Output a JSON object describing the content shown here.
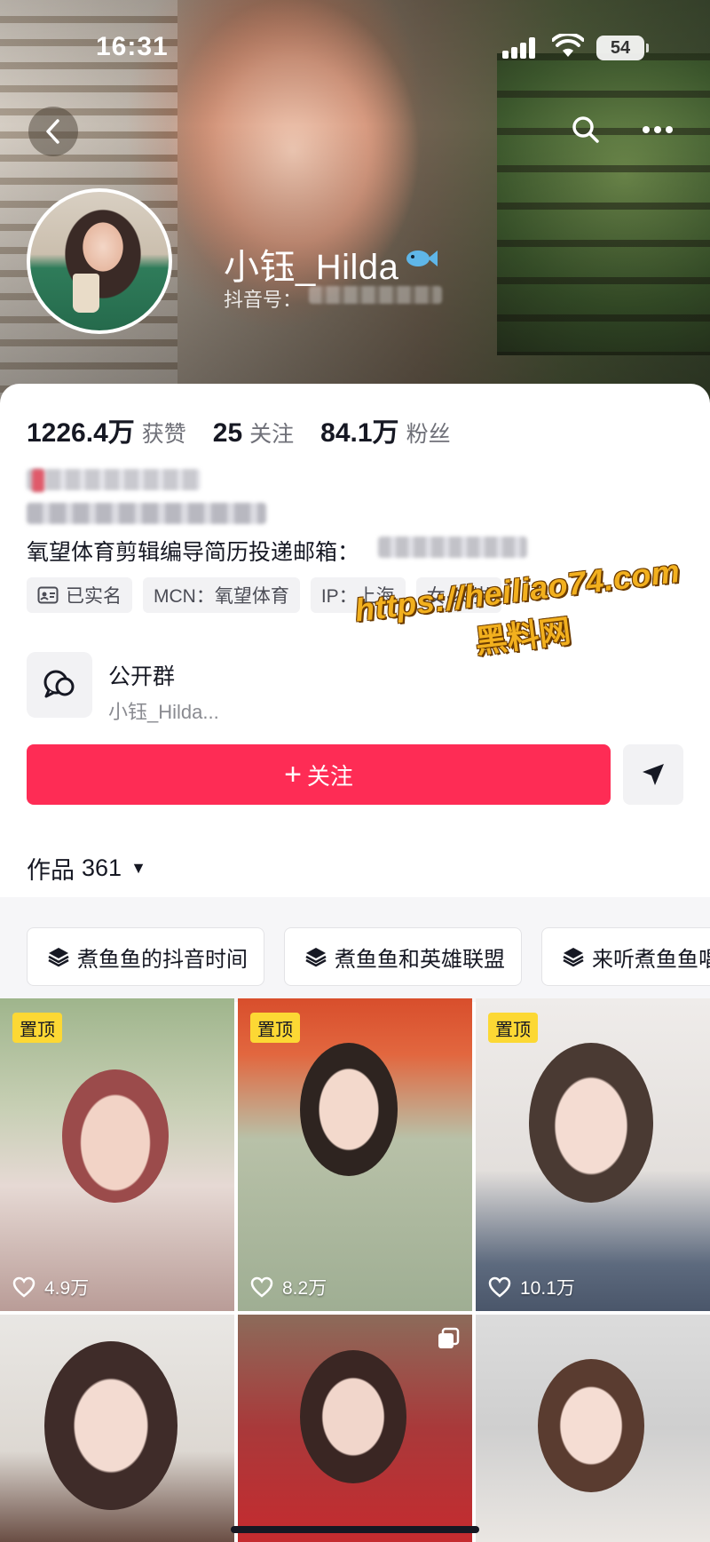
{
  "status_bar": {
    "time": "16:31",
    "battery": "54",
    "icons": [
      "signal-icon",
      "wifi-icon",
      "battery-icon"
    ]
  },
  "header": {
    "icons": [
      "back-icon",
      "search-icon",
      "more-icon"
    ]
  },
  "profile": {
    "display_name": "小钰_Hilda",
    "douyin_id_label": "抖音号：",
    "stats": [
      {
        "value": "1226.4万",
        "label": "获赞"
      },
      {
        "value": "25",
        "label": "关注"
      },
      {
        "value": "84.1万",
        "label": "粉丝"
      }
    ],
    "bio_line": "氧望体育剪辑编导简历投递邮箱：",
    "tags": [
      "已实名",
      "MCN：氧望体育",
      "IP：上海",
      "女·29岁"
    ]
  },
  "group": {
    "title": "公开群",
    "subtitle": "小钰_Hilda..."
  },
  "watermark": {
    "url": "https://heiliao74.com",
    "text": "黑料网"
  },
  "actions": {
    "follow_plus": "+",
    "follow_label": "关注"
  },
  "works": {
    "label": "作品",
    "count": "361",
    "caret": "▼"
  },
  "collections": [
    "煮鱼鱼的抖音时间",
    "煮鱼鱼和英雄联盟",
    "来听煮鱼鱼唱"
  ],
  "videos": [
    {
      "pinned": "置顶",
      "likes": "4.9万"
    },
    {
      "pinned": "置顶",
      "likes": "8.2万"
    },
    {
      "pinned": "置顶",
      "likes": "10.1万"
    },
    {},
    {},
    {}
  ],
  "colors": {
    "accent": "#fe2c55",
    "pin_badge": "#fcd834",
    "watermark": "#f2b01e"
  }
}
